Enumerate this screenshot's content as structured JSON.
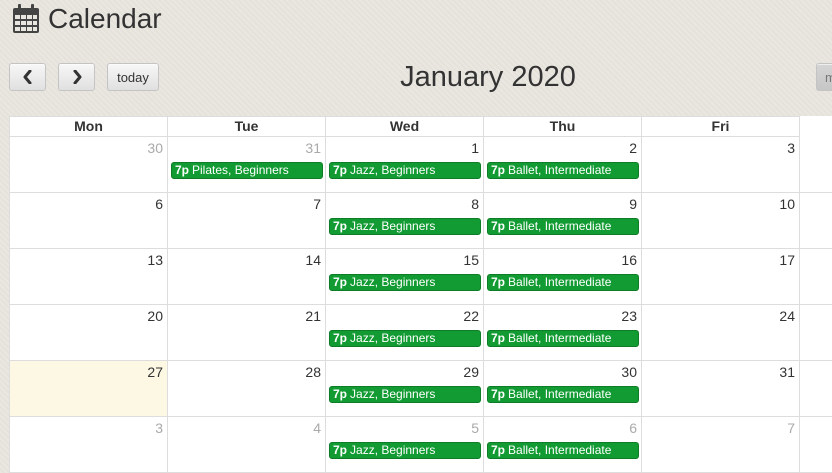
{
  "page": {
    "title": "Calendar"
  },
  "toolbar": {
    "today_label": "today",
    "view_label": "m"
  },
  "calendar": {
    "month_title": "January 2020",
    "day_headers": [
      "Mon",
      "Tue",
      "Wed",
      "Thu",
      "Fri"
    ],
    "today_date": "27",
    "weeks": [
      [
        {
          "date": "30",
          "other": true,
          "event": null
        },
        {
          "date": "31",
          "other": true,
          "event": {
            "time": "7p",
            "title": "Pilates, Beginners"
          }
        },
        {
          "date": "1",
          "other": false,
          "event": {
            "time": "7p",
            "title": "Jazz, Beginners"
          }
        },
        {
          "date": "2",
          "other": false,
          "event": {
            "time": "7p",
            "title": "Ballet, Intermediate"
          }
        },
        {
          "date": "3",
          "other": false,
          "event": null
        }
      ],
      [
        {
          "date": "6",
          "other": false,
          "event": null
        },
        {
          "date": "7",
          "other": false,
          "event": null
        },
        {
          "date": "8",
          "other": false,
          "event": {
            "time": "7p",
            "title": "Jazz, Beginners"
          }
        },
        {
          "date": "9",
          "other": false,
          "event": {
            "time": "7p",
            "title": "Ballet, Intermediate"
          }
        },
        {
          "date": "10",
          "other": false,
          "event": null
        }
      ],
      [
        {
          "date": "13",
          "other": false,
          "event": null
        },
        {
          "date": "14",
          "other": false,
          "event": null
        },
        {
          "date": "15",
          "other": false,
          "event": {
            "time": "7p",
            "title": "Jazz, Beginners"
          }
        },
        {
          "date": "16",
          "other": false,
          "event": {
            "time": "7p",
            "title": "Ballet, Intermediate"
          }
        },
        {
          "date": "17",
          "other": false,
          "event": null
        }
      ],
      [
        {
          "date": "20",
          "other": false,
          "event": null
        },
        {
          "date": "21",
          "other": false,
          "event": null
        },
        {
          "date": "22",
          "other": false,
          "event": {
            "time": "7p",
            "title": "Jazz, Beginners"
          }
        },
        {
          "date": "23",
          "other": false,
          "event": {
            "time": "7p",
            "title": "Ballet, Intermediate"
          }
        },
        {
          "date": "24",
          "other": false,
          "event": null
        }
      ],
      [
        {
          "date": "27",
          "other": false,
          "event": null
        },
        {
          "date": "28",
          "other": false,
          "event": null
        },
        {
          "date": "29",
          "other": false,
          "event": {
            "time": "7p",
            "title": "Jazz, Beginners"
          }
        },
        {
          "date": "30",
          "other": false,
          "event": {
            "time": "7p",
            "title": "Ballet, Intermediate"
          }
        },
        {
          "date": "31",
          "other": false,
          "event": null
        }
      ],
      [
        {
          "date": "3",
          "other": true,
          "event": null
        },
        {
          "date": "4",
          "other": true,
          "event": null
        },
        {
          "date": "5",
          "other": true,
          "event": {
            "time": "7p",
            "title": "Jazz, Beginners"
          }
        },
        {
          "date": "6",
          "other": true,
          "event": {
            "time": "7p",
            "title": "Ballet, Intermediate"
          }
        },
        {
          "date": "7",
          "other": true,
          "event": null
        }
      ]
    ]
  },
  "colors": {
    "event_bg": "#129b32",
    "today_bg": "#fcf8e3",
    "other_month_text": "#aaa"
  }
}
